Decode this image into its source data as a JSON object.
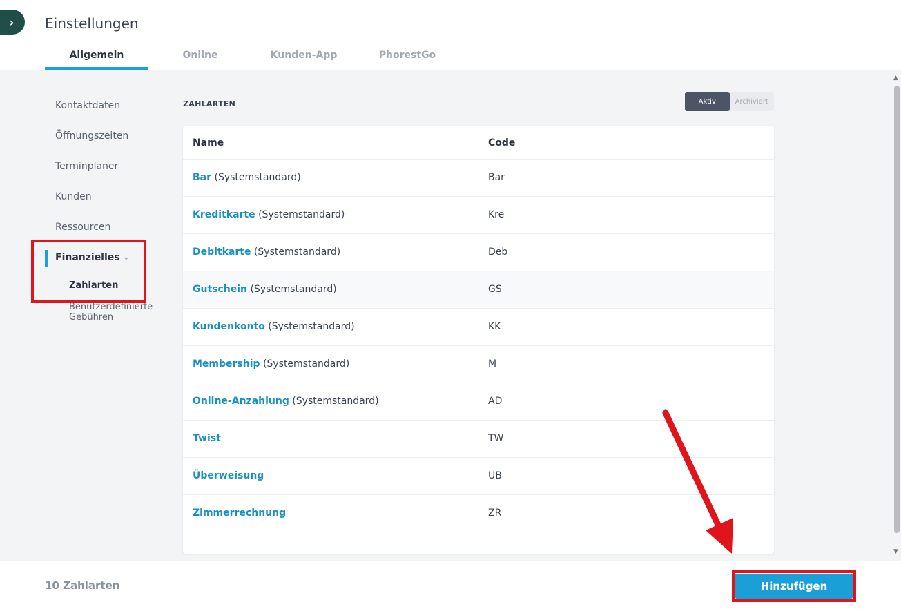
{
  "header": {
    "title": "Einstellungen",
    "expand_icon": "›",
    "tabs": [
      {
        "label": "Allgemein",
        "active": true
      },
      {
        "label": "Online",
        "active": false
      },
      {
        "label": "Kunden-App",
        "active": false
      },
      {
        "label": "PhorestGo",
        "active": false
      }
    ]
  },
  "sidebar": {
    "items": [
      "Kontaktdaten",
      "Öffnungszeiten",
      "Terminplaner",
      "Kunden",
      "Ressourcen"
    ],
    "active_parent": "Finanzielles",
    "chevron": "⌄",
    "sub_items": [
      "Zahlarten",
      "Benutzerdefinierte Gebühren"
    ]
  },
  "section": {
    "title": "ZAHLARTEN",
    "toggle": {
      "active": "Aktiv",
      "inactive": "Archiviert"
    }
  },
  "table": {
    "headers": {
      "name": "Name",
      "code": "Code"
    },
    "rows": [
      {
        "name": "Bar",
        "suffix": " (Systemstandard)",
        "code": "Bar"
      },
      {
        "name": "Kreditkarte",
        "suffix": " (Systemstandard)",
        "code": "Kre"
      },
      {
        "name": "Debitkarte",
        "suffix": " (Systemstandard)",
        "code": "Deb"
      },
      {
        "name": "Gutschein",
        "suffix": " (Systemstandard)",
        "code": "GS"
      },
      {
        "name": "Kundenkonto",
        "suffix": " (Systemstandard)",
        "code": "KK"
      },
      {
        "name": "Membership",
        "suffix": " (Systemstandard)",
        "code": "M"
      },
      {
        "name": "Online-Anzahlung",
        "suffix": " (Systemstandard)",
        "code": "AD"
      },
      {
        "name": "Twist",
        "suffix": "",
        "code": "TW"
      },
      {
        "name": "Überweisung",
        "suffix": "",
        "code": "UB"
      },
      {
        "name": "Zimmerrechnung",
        "suffix": "",
        "code": "ZR"
      }
    ]
  },
  "footer": {
    "count": "10 Zahlarten",
    "add_label": "Hinzufügen"
  },
  "colors": {
    "accent": "#1a9fd6",
    "link": "#1a8fc4",
    "annotation": "#e0141b",
    "toggle_active": "#4b5566"
  }
}
